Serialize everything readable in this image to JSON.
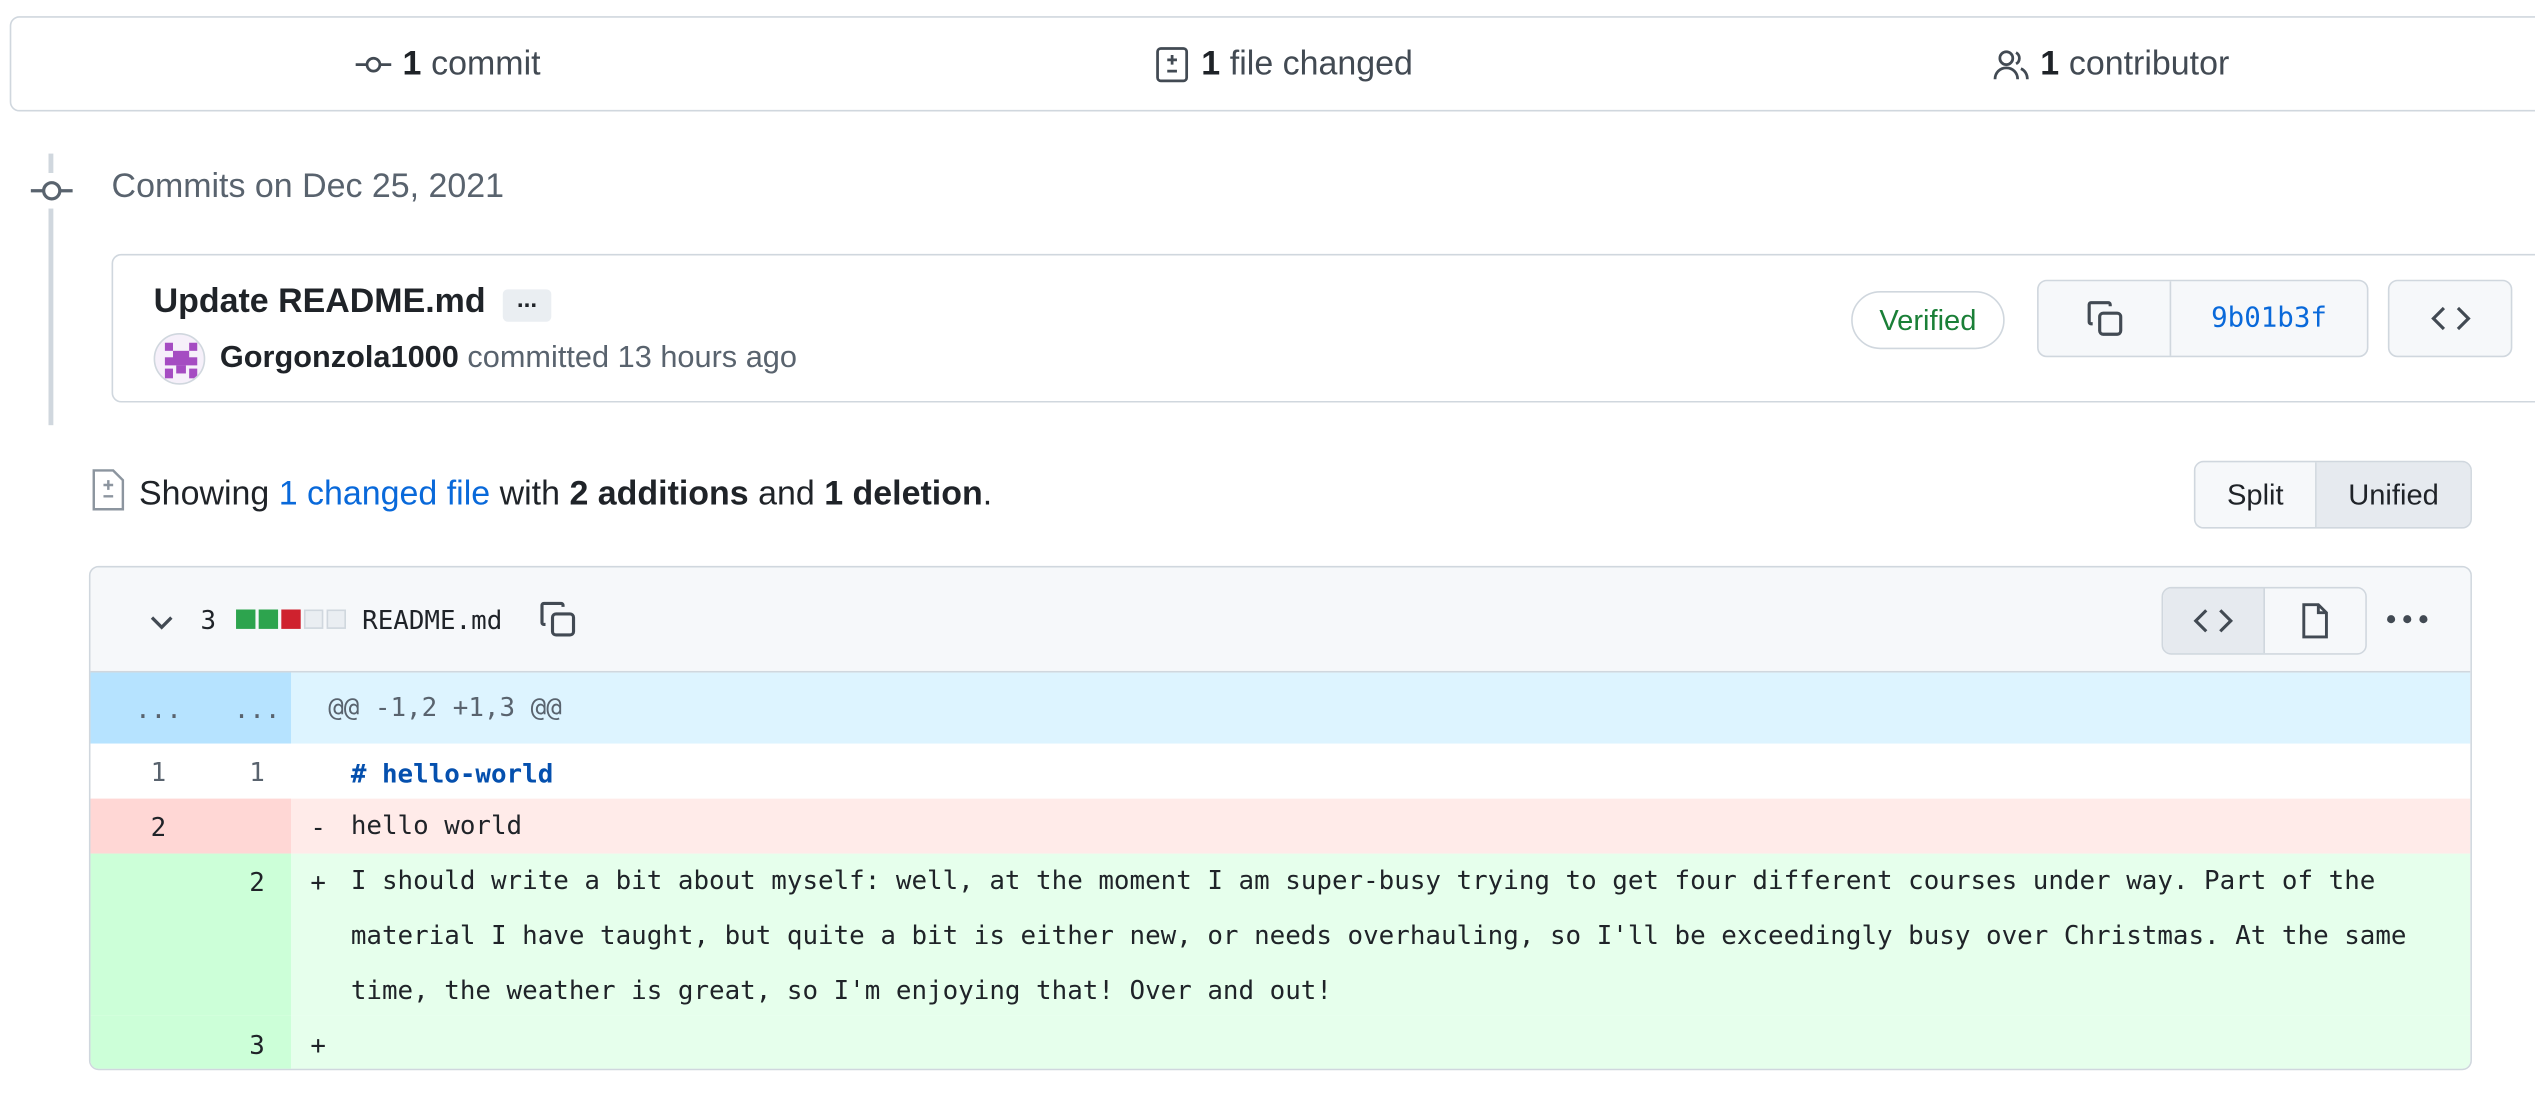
{
  "summary": {
    "commits_count": "1",
    "commits_label": "commit",
    "files_count": "1",
    "files_label": "file changed",
    "contributors_count": "1",
    "contributors_label": "contributor"
  },
  "timeline": {
    "commits_on": "Commits on Dec 25, 2021"
  },
  "commit": {
    "title": "Update README.md",
    "ellipsis": "...",
    "author": "Gorgonzola1000",
    "action": "committed 13 hours ago",
    "verified": "Verified",
    "sha": "9b01b3f"
  },
  "showing": {
    "prefix": "Showing",
    "changed_link": "1 changed file",
    "with": "with",
    "additions": "2 additions",
    "and": "and",
    "deletions": "1 deletion",
    "end": "."
  },
  "view_toggle": {
    "split": "Split",
    "unified": "Unified",
    "selected": "Unified"
  },
  "diff": {
    "count": "3",
    "blocks": [
      "add",
      "add",
      "del",
      "neutral",
      "neutral"
    ],
    "filename": "README.md",
    "hunk_header": "@@ -1,2 +1,3 @@",
    "hunk_left": "...",
    "hunk_right": "...",
    "lines": [
      {
        "old": "1",
        "new": "1",
        "sign": "",
        "text": "# hello-world",
        "type": "context"
      },
      {
        "old": "2",
        "new": "",
        "sign": "-",
        "text": "hello world",
        "type": "del"
      },
      {
        "old": "",
        "new": "2",
        "sign": "+",
        "text": "I should write a bit about myself: well, at the moment I am super-busy trying to get four different courses under way. Part of the material I have taught, but quite a bit is either new, or needs overhauling, so I'll be exceedingly busy over Christmas. At the same time, the weather is great, so I'm enjoying that! Over and out!",
        "type": "add"
      },
      {
        "old": "",
        "new": "3",
        "sign": "+",
        "text": "",
        "type": "add"
      }
    ]
  },
  "colors": {
    "add_bg": "#e6ffec",
    "add_gutter": "#ccffd8",
    "del_bg": "#ffebe9",
    "del_gutter": "#ffd7d5",
    "hunk_bg": "#ddf4ff",
    "hunk_gutter": "#b6e3ff",
    "link": "#0969da",
    "verified": "#1a7f37",
    "block_add": "#2da44e",
    "block_del": "#cf222e",
    "block_neutral": "#eaeef2"
  },
  "icons": [
    "commit-icon",
    "file-diff-icon",
    "people-icon",
    "copy-icon",
    "code-icon",
    "chevron-down-icon",
    "file-icon",
    "kebab-horizontal-icon"
  ]
}
